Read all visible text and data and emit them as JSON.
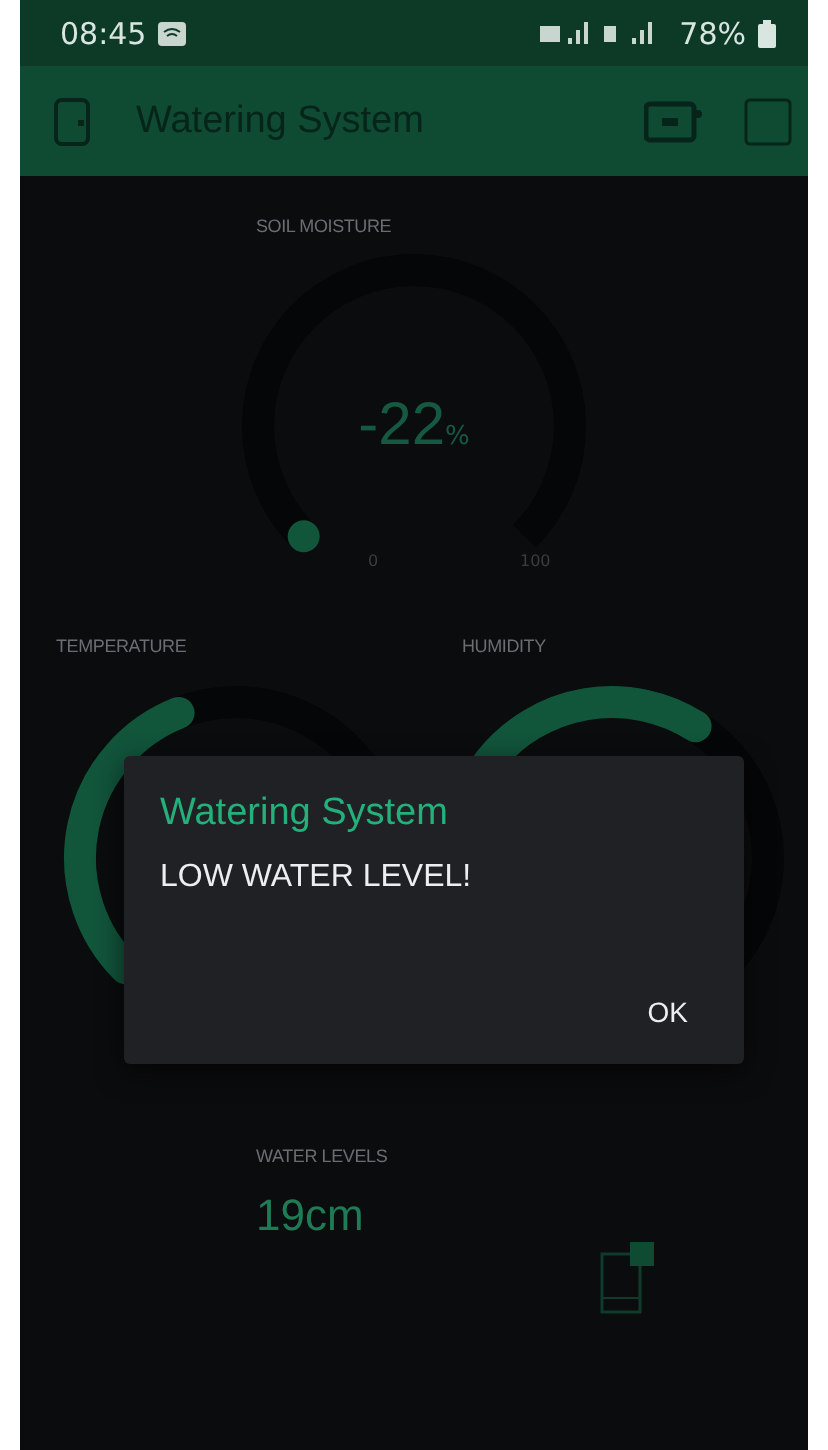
{
  "status_bar": {
    "time": "08:45",
    "battery": "78%"
  },
  "app_bar": {
    "title": "Watering System"
  },
  "soil_moisture": {
    "label": "SOIL MOISTURE",
    "value": "-22",
    "unit": "%",
    "min": "0",
    "max": "100"
  },
  "temperature": {
    "label": "TEMPERATURE"
  },
  "humidity": {
    "label": "HUMIDITY"
  },
  "water_levels": {
    "label": "WATER LEVELS",
    "value": "19cm"
  },
  "dialog": {
    "title": "Watering System",
    "message": "LOW WATER LEVEL!",
    "button": "OK"
  }
}
